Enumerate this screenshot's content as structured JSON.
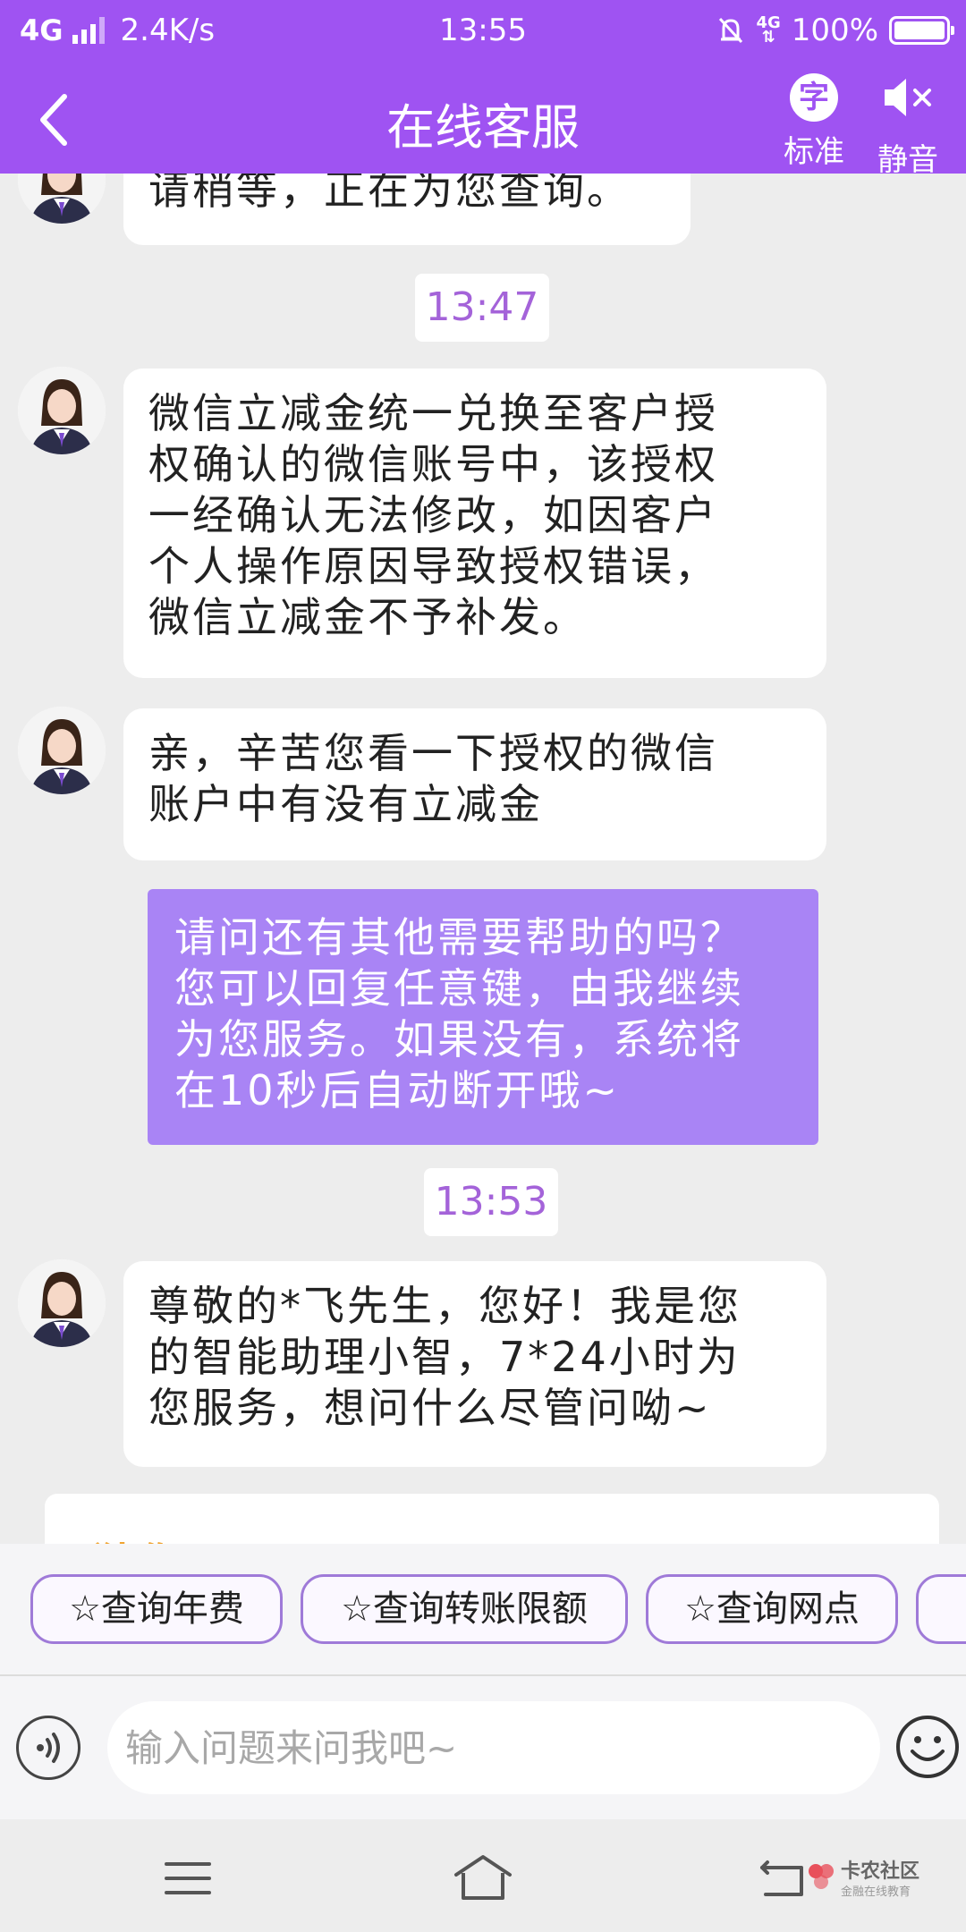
{
  "status_bar": {
    "network": "4G",
    "speed": "2.4K/s",
    "time": "13:55",
    "network_right": "4G",
    "battery": "100%"
  },
  "header": {
    "title": "在线客服",
    "font_char": "字",
    "font_label": "标准",
    "mute_label": "静音",
    "color": "#9f53f2"
  },
  "messages": [
    {
      "role": "agent",
      "text": "请稍等，正在为您查询。"
    },
    {
      "role": "timestamp",
      "text": "13:47"
    },
    {
      "role": "agent",
      "lines": [
        "微信立减金统一兑换至客户授",
        "权确认的微信账号中，该授权",
        "一经确认无法修改，如因客户",
        "个人操作原因导致授权错误，",
        "微信立减金不予补发。"
      ]
    },
    {
      "role": "agent",
      "lines": [
        "亲，辛苦您看一下授权的微信",
        "账户中有没有立减金"
      ]
    },
    {
      "role": "system",
      "lines": [
        "请问还有其他需要帮助的吗？",
        "您可以回复任意键，由我继续",
        "为您服务。如果没有，系统将",
        "在10秒后自动断开哦~"
      ]
    },
    {
      "role": "timestamp",
      "text": "13:53"
    },
    {
      "role": "agent",
      "lines": [
        "尊敬的*飞先生，您好！我是您",
        "的智能助理小智，7*24小时为",
        "您服务，想问什么尽管问呦~"
      ]
    }
  ],
  "card_peek_text": "猜你",
  "quick_chips": [
    "☆查询年费",
    "☆查询转账限额",
    "☆查询网点"
  ],
  "input": {
    "placeholder": "输入问题来问我吧~",
    "value": ""
  },
  "icons": {
    "back": "chevron-left-icon",
    "mute": "speaker-muted-icon",
    "voice": "voice-wave-icon",
    "emoji": "smiley-icon",
    "nav_menu": "menu-icon",
    "nav_home": "home-icon",
    "nav_back": "return-icon"
  },
  "watermark": {
    "title": "卡农社区",
    "subtitle": "金融在线教育"
  },
  "colors": {
    "accent": "#9f53f2",
    "user_bubble": "#a984f5",
    "timestamp": "#a463d9",
    "chip_border": "#9f7ad8",
    "card_title": "#f0a431"
  }
}
